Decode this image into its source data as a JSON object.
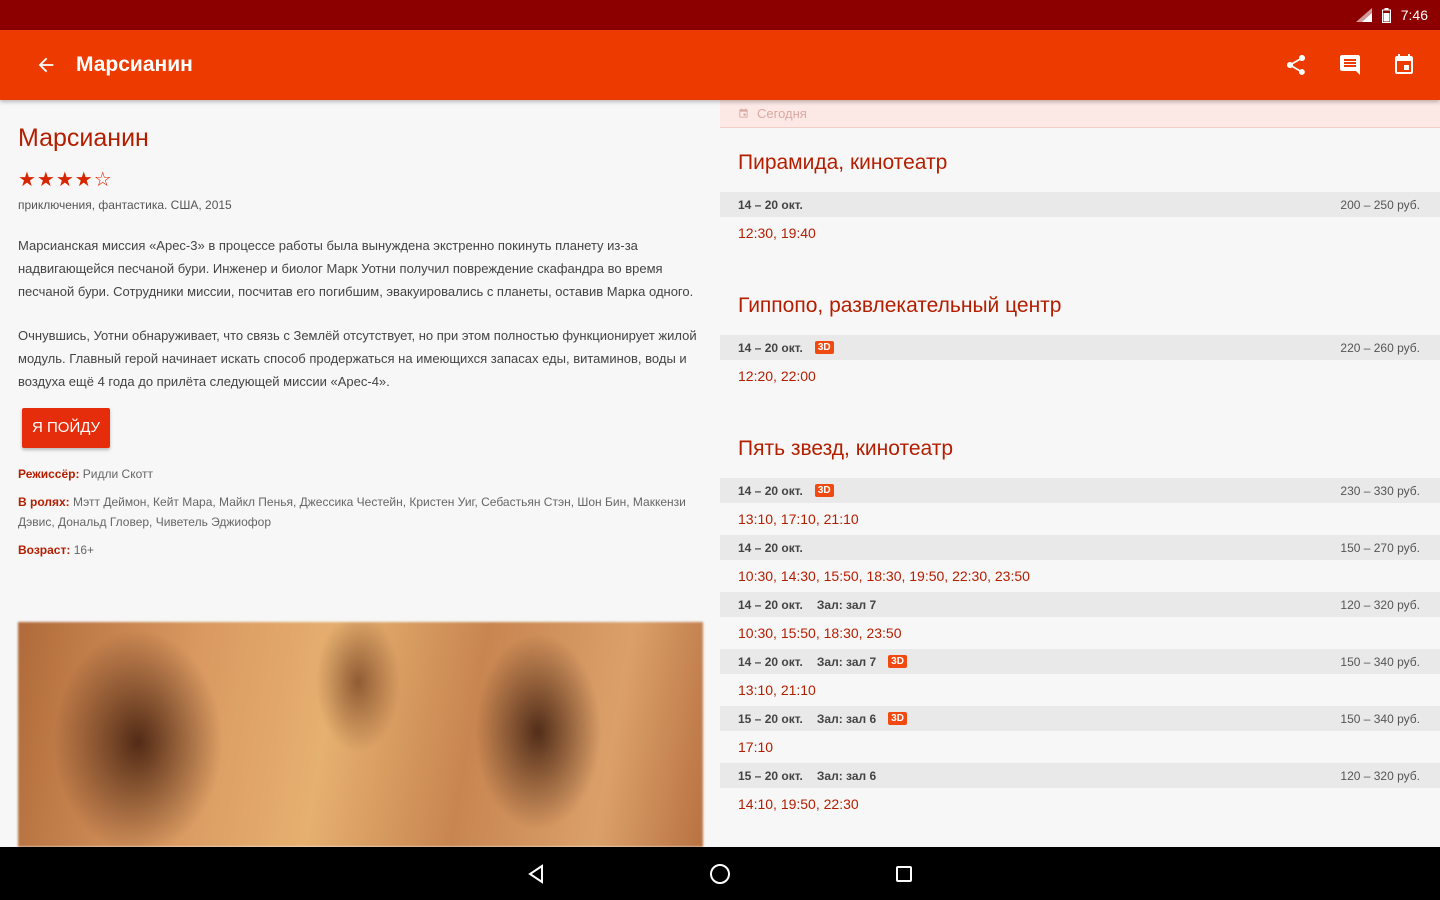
{
  "status": {
    "time": "7:46"
  },
  "appbar": {
    "title": "Марсианин"
  },
  "movie": {
    "title": "Марсианин",
    "stars": "★★★★☆",
    "genre": "приключения, фантастика. США, 2015",
    "desc1": "Марсианская миссия «Арес-3» в процессе работы была вынуждена экстренно покинуть планету из-за надвигающейся песчаной бури. Инженер и биолог Марк Уотни получил повреждение скафандра во время песчаной бури. Сотрудники миссии, посчитав его погибшим, эвакуировались с планеты, оставив Марка одного.",
    "desc2": "Очнувшись, Уотни обнаруживает, что связь с Землёй отсутствует, но при этом полностью функционирует жилой модуль. Главный герой начинает искать способ продержаться на имеющихся запасах еды, витаминов, воды и воздуха ещё 4 года до прилёта следующей миссии «Арес-4».",
    "go_label": "Я ПОЙДУ",
    "director_key": "Режиссёр:",
    "director": "Ридли Скотт",
    "cast_key": "В ролях:",
    "cast": "Мэтт Деймон, Кейт Мара, Майкл Пенья, Джессика Честейн, Кристен Уиг, Себастьян Стэн, Шон Бин, Маккензи Дэвис, Дональд Гловер, Чиветель Эджиофор",
    "age_key": "Возраст:",
    "age": "16+"
  },
  "schedule": {
    "today": "Сегодня",
    "cinemas": [
      {
        "name": "Пирамида, кинотеатр",
        "sessions": [
          {
            "dates": "14 – 20 окт.",
            "hall": "",
            "badge": "",
            "price": "200 – 250 руб.",
            "times": "12:30, 19:40"
          }
        ]
      },
      {
        "name": "Гиппопо, развлекательный центр",
        "sessions": [
          {
            "dates": "14 – 20 окт.",
            "hall": "",
            "badge": "3D",
            "price": "220 – 260 руб.",
            "times": "12:20, 22:00"
          }
        ]
      },
      {
        "name": "Пять звезд, кинотеатр",
        "sessions": [
          {
            "dates": "14 – 20 окт.",
            "hall": "",
            "badge": "3D",
            "price": "230 – 330 руб.",
            "times": "13:10, 17:10, 21:10"
          },
          {
            "dates": "14 – 20 окт.",
            "hall": "",
            "badge": "",
            "price": "150 – 270 руб.",
            "times": "10:30, 14:30, 15:50, 18:30, 19:50, 22:30, 23:50"
          },
          {
            "dates": "14 – 20 окт.",
            "hall": "Зал: зал 7",
            "badge": "",
            "price": "120 – 320 руб.",
            "times": "10:30, 15:50, 18:30, 23:50"
          },
          {
            "dates": "14 – 20 окт.",
            "hall": "Зал: зал 7",
            "badge": "3D",
            "price": "150 – 340 руб.",
            "times": "13:10, 21:10"
          },
          {
            "dates": "15 – 20 окт.",
            "hall": "Зал: зал 6",
            "badge": "3D",
            "price": "150 – 340 руб.",
            "times": "17:10"
          },
          {
            "dates": "15 – 20 окт.",
            "hall": "Зал: зал 6",
            "badge": "",
            "price": "120 – 320 руб.",
            "times": "14:10, 19:50, 22:30"
          }
        ]
      }
    ]
  },
  "icons": {
    "back": "arrow-left-icon",
    "share": "share-icon",
    "comment": "comment-icon",
    "calendar": "calendar-icon"
  },
  "colors": {
    "statusbar": "#8c0000",
    "appbar": "#ec3a00",
    "accent": "#b41e00",
    "button": "#e52d0b",
    "badge": "#f04a10"
  }
}
